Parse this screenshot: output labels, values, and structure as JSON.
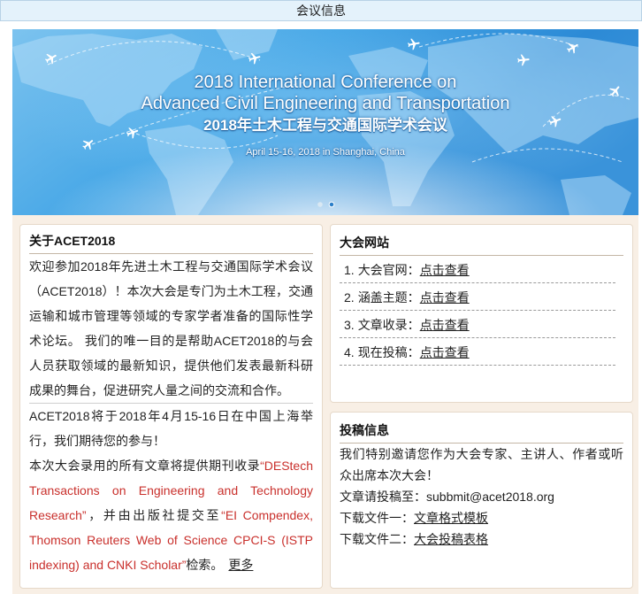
{
  "header": {
    "title": "会议信息"
  },
  "banner": {
    "title_line1": "2018 International Conference on",
    "title_line2": "Advanced Civil Engineering and Transportation",
    "title_cn": "2018年土木工程与交通国际学术会议",
    "date_location": "April 15-16, 2018 in Shanghai, China",
    "carousel": {
      "slides": 2,
      "active": 2
    }
  },
  "about": {
    "heading": "关于ACET2018",
    "intro": "欢迎参加2018年先进土木工程与交通国际学术会议（ACET2018）！本次大会是专门为土木工程，交通运输和城市管理等领域的专家学者准备的国际性学术论坛。 我们的唯一目的是帮助ACET2018的与会人员获取领域的最新知识，提供他们发表最新科研成果的舞台，促进研究人量之间的交流和合作。",
    "schedule": "ACET2018将于2018年4月15-16日在中国上海举行，我们期待您的参与！",
    "publication": {
      "text_before": "本次大会录用的所有文章将提供期刊收录",
      "journal": "“DEStech Transactions on Engineering and Technology Research”",
      "text_middle": "，并由出版社提交至",
      "indexing": "“EI Compendex, Thomson Reuters Web of Science CPCI-S (ISTP indexing) and CNKI Scholar”",
      "text_after": "检索。",
      "more_link": "更多"
    }
  },
  "website": {
    "heading": "大会网站",
    "items": [
      {
        "number": "1.",
        "label": "大会官网：",
        "link": "点击查看"
      },
      {
        "number": "2.",
        "label": "涵盖主题：",
        "link": "点击查看"
      },
      {
        "number": "3.",
        "label": "文章收录：",
        "link": "点击查看"
      },
      {
        "number": "4.",
        "label": "现在投稿：",
        "link": "点击查看"
      }
    ]
  },
  "submission": {
    "heading": "投稿信息",
    "invitation": "我们特别邀请您作为大会专家、主讲人、作者或听众出席本次大会！",
    "email_label": "文章请投稿至：",
    "email": "subbmit@acet2018.org",
    "downloads": [
      {
        "label": "下载文件一：",
        "link": "文章格式模板"
      },
      {
        "label": "下载文件二：",
        "link": "大会投稿表格"
      }
    ]
  },
  "icons": {
    "banner_planes": "airplane-icon"
  },
  "colors": {
    "accent_red": "#c9302c",
    "page_background": "#f8efe5",
    "header_background": "#e4f2fb",
    "banner_blue": "#45a6e6"
  }
}
